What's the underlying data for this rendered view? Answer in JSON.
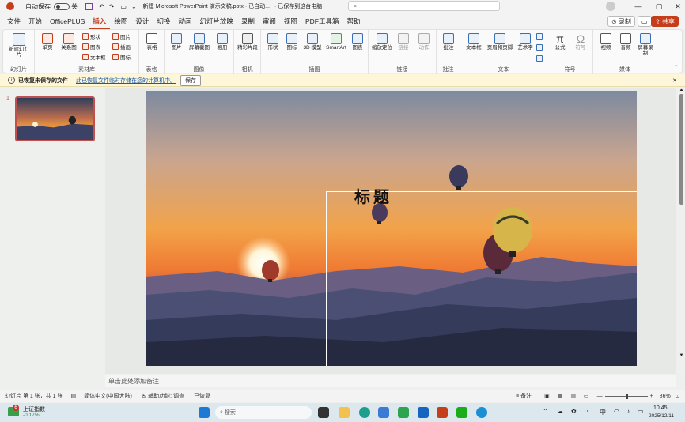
{
  "titlebar": {
    "autosave_label": "自动保存",
    "autosave_state": "关",
    "doc_title": "新建 Microsoft PowerPoint 演示文稿.pptx · 已自动...",
    "save_status": "· 已保存到这台电脑",
    "search_placeholder": "",
    "user_icon": "user-avatar-icon"
  },
  "tabs": [
    "文件",
    "开始",
    "OfficePLUS",
    "插入",
    "绘图",
    "设计",
    "切换",
    "动画",
    "幻灯片放映",
    "录制",
    "审阅",
    "视图",
    "PDF工具箱",
    "帮助"
  ],
  "active_tab": "插入",
  "top_right": {
    "record": "录制",
    "share": "共享"
  },
  "ribbon": {
    "groups": [
      {
        "label": "幻灯片",
        "buttons": [
          "新建幻灯片"
        ]
      },
      {
        "label": "素材库",
        "buttons": [
          "单页",
          "关系图",
          "形状",
          "图表",
          "文本框",
          "图片",
          "插画",
          "图标"
        ]
      },
      {
        "label": "表格",
        "buttons": [
          "表格"
        ]
      },
      {
        "label": "图像",
        "buttons": [
          "图片",
          "屏幕截图",
          "相册"
        ]
      },
      {
        "label": "相机",
        "buttons": [
          "精彩片段"
        ]
      },
      {
        "label": "插图",
        "buttons": [
          "形状",
          "图标",
          "3D 模型",
          "SmartArt",
          "图表"
        ]
      },
      {
        "label": "链接",
        "buttons": [
          "缩放定位",
          "链接",
          "动作"
        ]
      },
      {
        "label": "批注",
        "buttons": [
          "批注"
        ]
      },
      {
        "label": "文本",
        "buttons": [
          "文本框",
          "页眉和页脚",
          "艺术字"
        ]
      },
      {
        "label": "符号",
        "buttons": [
          "公式",
          "符号"
        ]
      },
      {
        "label": "媒体",
        "buttons": [
          "视频",
          "音频",
          "屏幕录制"
        ]
      }
    ]
  },
  "infobar": {
    "title": "已恢复未保存的文件",
    "message": "此已恢复文件临时存储在您的计算机中。",
    "save_button": "保存"
  },
  "thumbnails": [
    {
      "number": "1"
    }
  ],
  "slide": {
    "title": "标题"
  },
  "notes_placeholder": "单击此处添加备注",
  "status": {
    "slide_info": "幻灯片 第 1 张，共 1 张",
    "language": "简体中文(中国大陆)",
    "accessibility": "辅助功能: 调查",
    "recovered": "已恢复",
    "notes_btn": "备注",
    "zoom": "86%"
  },
  "taskbar": {
    "stock_name": "上证指数",
    "stock_change": "-0.17%",
    "badge": "6",
    "search_placeholder": "搜索",
    "ime": "中",
    "time": "10:45",
    "date": "2025/12/11"
  },
  "colors": {
    "accent": "#c43e1c",
    "share": "#c43e1c"
  }
}
